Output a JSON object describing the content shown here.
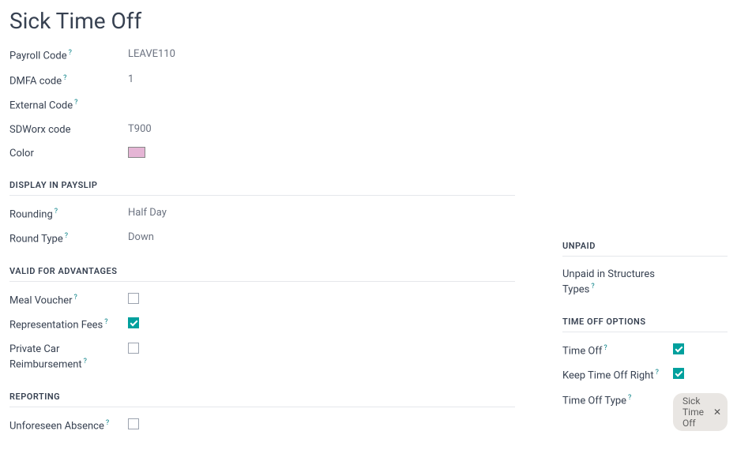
{
  "page_title": "Sick Time Off",
  "top_fields": {
    "payroll_code_label": "Payroll Code",
    "payroll_code_value": "LEAVE110",
    "dmfa_code_label": "DMFA code",
    "dmfa_code_value": "1",
    "external_code_label": "External Code",
    "external_code_value": "",
    "sdworx_code_label": "SDWorx code",
    "sdworx_code_value": "T900",
    "color_label": "Color",
    "color_value": "#e5b5d5"
  },
  "sections": {
    "display_in_payslip": {
      "title": "DISPLAY IN PAYSLIP",
      "rounding_label": "Rounding",
      "rounding_value": "Half Day",
      "round_type_label": "Round Type",
      "round_type_value": "Down"
    },
    "valid_for_advantages": {
      "title": "VALID FOR ADVANTAGES",
      "meal_voucher_label": "Meal Voucher",
      "meal_voucher_checked": false,
      "representation_fees_label": "Representation Fees",
      "representation_fees_checked": true,
      "private_car_label": "Private Car Reimbursement",
      "private_car_checked": false
    },
    "reporting": {
      "title": "REPORTING",
      "unforeseen_absence_label": "Unforeseen Absence",
      "unforeseen_absence_checked": false
    },
    "unpaid": {
      "title": "UNPAID",
      "unpaid_structures_label": "Unpaid in Structures Types",
      "unpaid_structures_value": ""
    },
    "time_off_options": {
      "title": "TIME OFF OPTIONS",
      "time_off_label": "Time Off",
      "time_off_checked": true,
      "keep_right_label": "Keep Time Off Right",
      "keep_right_checked": true,
      "time_off_type_label": "Time Off Type",
      "time_off_type_value": "Sick Time Off"
    }
  },
  "help_glyph": "?"
}
